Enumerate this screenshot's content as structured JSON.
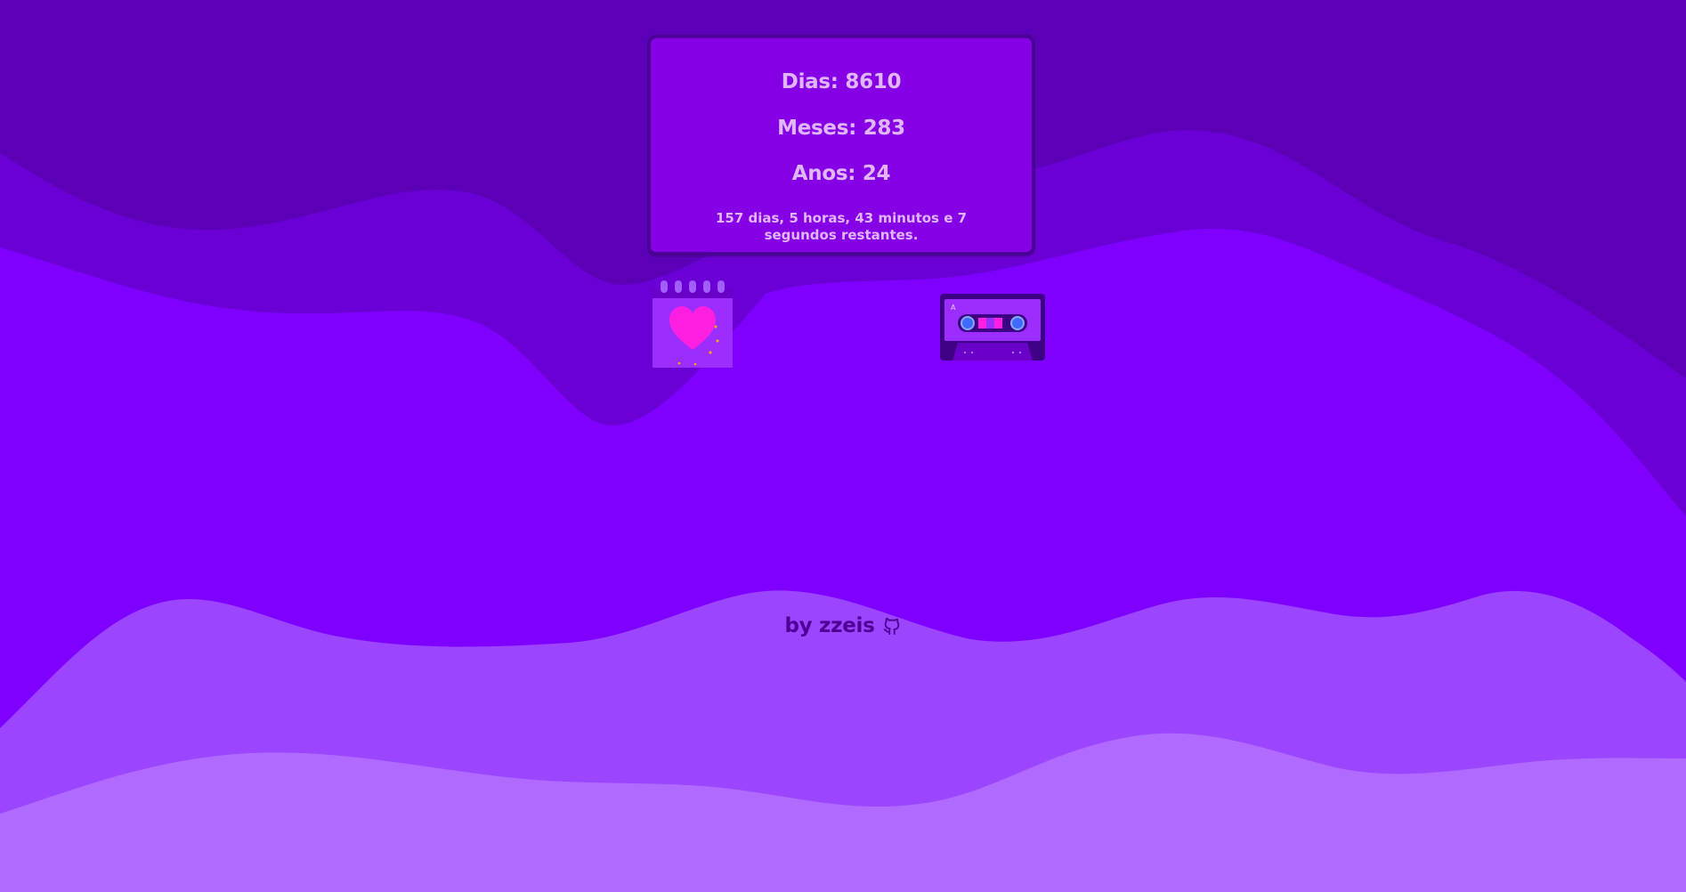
{
  "counter": {
    "days_label": "Dias: 8610",
    "months_label": "Meses: 283",
    "years_label": "Anos: 24",
    "remaining_text": "157 dias, 5 horas, 43 minutos e 7 segundos restantes."
  },
  "icons": {
    "calendar": "calendar-heart-icon",
    "cassette": "cassette-tape-icon",
    "cassette_side_label": "A",
    "github": "github-icon"
  },
  "footer": {
    "credit": "by zzeis"
  },
  "colors": {
    "background_dark": "#5c00b8",
    "wave_mid": "#6b00d6",
    "wave_main": "#8000ff",
    "wave_light": "#9b45ff",
    "wave_lighter": "#b06aff",
    "card_fill": "#8600e6",
    "card_border": "#4a0096",
    "text_light": "#e0b6ff",
    "footer_text": "#4e0097",
    "heart": "#ff1fe0"
  }
}
